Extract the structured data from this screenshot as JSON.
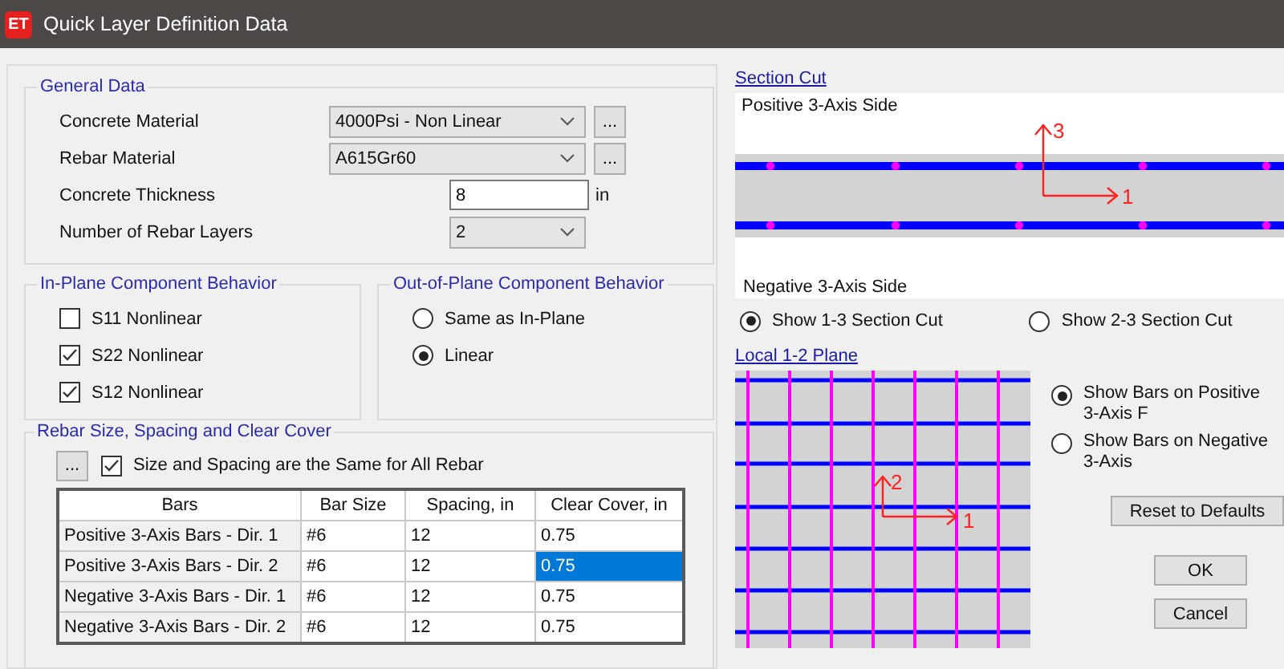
{
  "window": {
    "icon_text": "ET",
    "title": "Quick Layer Definition Data"
  },
  "general_data": {
    "title": "General Data",
    "fields": [
      {
        "kind": "dropdown",
        "label": "Concrete Material",
        "value": "4000Psi - Non Linear",
        "button": "..."
      },
      {
        "kind": "dropdown",
        "label": "Rebar Material",
        "value": "A615Gr60",
        "button": "..."
      },
      {
        "kind": "text",
        "label": "Concrete Thickness",
        "value": "8",
        "unit": "in"
      },
      {
        "kind": "short_dropdown",
        "label": "Number of Rebar Layers",
        "value": "2"
      }
    ]
  },
  "in_plane": {
    "title": "In-Plane Component Behavior",
    "checkboxes": [
      {
        "label": "S11 Nonlinear",
        "checked": false
      },
      {
        "label": "S22 Nonlinear",
        "checked": true
      },
      {
        "label": "S12 Nonlinear",
        "checked": true
      }
    ]
  },
  "out_of_plane": {
    "title": "Out-of-Plane Component Behavior",
    "options": [
      {
        "label": "Same as In-Plane",
        "selected": false
      },
      {
        "label": "Linear",
        "selected": true
      }
    ]
  },
  "rebar": {
    "title": "Rebar Size, Spacing and Clear Cover",
    "button": "...",
    "same_checkbox": {
      "label": "Size and Spacing are the Same for All Rebar",
      "checked": true
    },
    "table": {
      "columns": [
        "Bars",
        "Bar Size",
        "Spacing, in",
        "Clear Cover, in"
      ],
      "rows": [
        {
          "cells": [
            {
              "text": "Positive 3-Axis Bars - Dir. 1",
              "selected": false
            },
            {
              "text": "#6",
              "selected": false
            },
            {
              "text": "12",
              "selected": false
            },
            {
              "text": "0.75",
              "selected": false
            }
          ]
        },
        {
          "cells": [
            {
              "text": "Positive 3-Axis Bars - Dir. 2",
              "selected": false
            },
            {
              "text": "#6",
              "selected": false
            },
            {
              "text": "12",
              "selected": false
            },
            {
              "text": "0.75",
              "selected": true
            }
          ]
        },
        {
          "cells": [
            {
              "text": "Negative 3-Axis Bars - Dir. 1",
              "selected": false
            },
            {
              "text": "#6",
              "selected": false
            },
            {
              "text": "12",
              "selected": false
            },
            {
              "text": "0.75",
              "selected": false
            }
          ]
        },
        {
          "cells": [
            {
              "text": "Negative 3-Axis Bars - Dir. 2",
              "selected": false
            },
            {
              "text": "#6",
              "selected": false
            },
            {
              "text": "12",
              "selected": false
            },
            {
              "text": "0.75",
              "selected": false
            }
          ]
        }
      ]
    }
  },
  "section_cut": {
    "title": "Section Cut",
    "positive_label": "Positive 3-Axis Side",
    "negative_label": "Negative 3-Axis Side",
    "axis_labels": [
      "3",
      "1"
    ],
    "options": [
      {
        "label": "Show 1-3 Section Cut",
        "selected": true
      },
      {
        "label": "Show 2-3 Section Cut",
        "selected": false
      }
    ]
  },
  "local_plane": {
    "title": "Local 1-2 Plane",
    "axis_labels": [
      "2",
      "1"
    ],
    "options": [
      {
        "label": "Show Bars on Positive 3-Axis F",
        "selected": true
      },
      {
        "label": "Show Bars on Negative 3-Axis",
        "selected": false
      }
    ]
  },
  "buttons": [
    {
      "kind": "reset",
      "label": "Reset to Defaults"
    },
    {
      "kind": "ok",
      "label": "OK"
    },
    {
      "kind": "cancel",
      "label": "Cancel"
    }
  ]
}
